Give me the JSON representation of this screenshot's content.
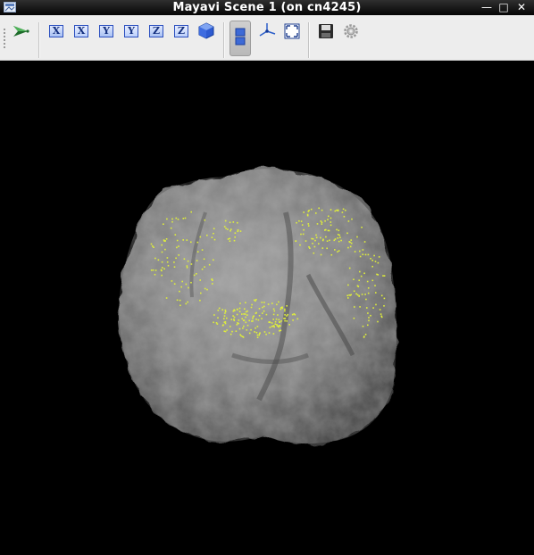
{
  "window": {
    "title": "Mayavi Scene 1 (on cn4245)",
    "controls": {
      "minimize": "—",
      "maximize": "□",
      "close": "✕"
    }
  },
  "toolbar": {
    "buttons": [
      {
        "name": "mayavi-engine-icon"
      },
      {
        "name": "view-x-plus-icon",
        "label": "X"
      },
      {
        "name": "view-x-minus-icon",
        "label": "X"
      },
      {
        "name": "view-y-plus-icon",
        "label": "Y"
      },
      {
        "name": "view-y-minus-icon",
        "label": "Y"
      },
      {
        "name": "view-z-plus-icon",
        "label": "Z"
      },
      {
        "name": "view-z-minus-icon",
        "label": "Z"
      },
      {
        "name": "isometric-view-icon"
      },
      {
        "name": "parallel-projection-toggle-icon",
        "state": "active"
      },
      {
        "name": "axes-indicator-icon"
      },
      {
        "name": "full-screen-icon"
      },
      {
        "name": "save-icon"
      },
      {
        "name": "configure-icon"
      }
    ]
  },
  "scene": {
    "background": "#000000",
    "surface_color": "#8a8a8a",
    "point_color": "#e0ef3a"
  }
}
